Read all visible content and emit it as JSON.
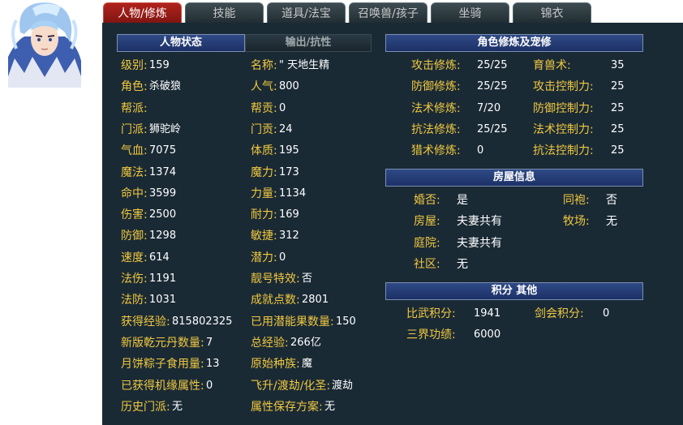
{
  "tabs": [
    "人物/修炼",
    "技能",
    "道具/法宝",
    "召唤兽/孩子",
    "坐骑",
    "锦衣"
  ],
  "status_header": "人物状态",
  "output_tab": "输出/抗性",
  "left_rows": [
    {
      "l1": "级别:",
      "v1": "159",
      "l2": "名称:",
      "v2": "\" 天地生精"
    },
    {
      "l1": "角色:",
      "v1": "杀破狼",
      "l2": "人气:",
      "v2": "800"
    },
    {
      "l1": "帮派:",
      "v1": "",
      "l2": "帮贡:",
      "v2": "0"
    },
    {
      "l1": "门派:",
      "v1": "狮驼岭",
      "l2": "门贡:",
      "v2": "24"
    },
    {
      "l1": "气血:",
      "v1": "7075",
      "l2": "体质:",
      "v2": "195"
    },
    {
      "l1": "魔法:",
      "v1": "1374",
      "l2": "魔力:",
      "v2": "173"
    },
    {
      "l1": "命中:",
      "v1": "3599",
      "l2": "力量:",
      "v2": "1134"
    },
    {
      "l1": "伤害:",
      "v1": "2500",
      "l2": "耐力:",
      "v2": "169"
    },
    {
      "l1": "防御:",
      "v1": "1298",
      "l2": "敏捷:",
      "v2": "312"
    },
    {
      "l1": "速度:",
      "v1": "614",
      "l2": "潜力:",
      "v2": "0"
    },
    {
      "l1": "法伤:",
      "v1": "1191",
      "l2": "靓号特效:",
      "v2": "否"
    },
    {
      "l1": "法防:",
      "v1": "1031",
      "l2": "成就点数:",
      "v2": "2801"
    },
    {
      "l1": "获得经验:",
      "v1": "815802325",
      "l2": "已用潜能果数量:",
      "v2": "150"
    },
    {
      "l1": "新版乾元丹数量:",
      "v1": "7",
      "l2": "总经验:",
      "v2": "266亿"
    },
    {
      "l1": "月饼粽子食用量:",
      "v1": "13",
      "l2": "原始种族:",
      "v2": "魔"
    },
    {
      "l1": "已获得机缘属性:",
      "v1": "0",
      "l2": "飞升/渡劫/化圣:",
      "v2": "渡劫"
    },
    {
      "l1": "历史门派:",
      "v1": "无",
      "l2": "属性保存方案:",
      "v2": "无"
    }
  ],
  "cultivation_header": "角色修炼及宠修",
  "cultivation_rows": [
    {
      "l1": "攻击修炼:",
      "v1": "25/25",
      "l2": "育兽术:",
      "v2": "35"
    },
    {
      "l1": "防御修炼:",
      "v1": "25/25",
      "l2": "攻击控制力:",
      "v2": "25"
    },
    {
      "l1": "法术修炼:",
      "v1": "7/20",
      "l2": "防御控制力:",
      "v2": "25"
    },
    {
      "l1": "抗法修炼:",
      "v1": "25/25",
      "l2": "法术控制力:",
      "v2": "25"
    },
    {
      "l1": "猎术修炼:",
      "v1": "0",
      "l2": "抗法控制力:",
      "v2": "25"
    }
  ],
  "house_header": "房屋信息",
  "house_rows": [
    {
      "l1": "婚否:",
      "v1": "是",
      "l2": "同袍:",
      "v2": "否"
    },
    {
      "l1": "房屋:",
      "v1": "夫妻共有",
      "l2": "牧场:",
      "v2": "无"
    },
    {
      "l1": "庭院:",
      "v1": "夫妻共有",
      "l2": "",
      "v2": ""
    },
    {
      "l1": "社区:",
      "v1": "无",
      "l2": "",
      "v2": ""
    }
  ],
  "score_header": "积分 其他",
  "score_rows": [
    {
      "l1": "比武积分:",
      "v1": "1941",
      "l2": "剑会积分:",
      "v2": "0"
    },
    {
      "l1": "三界功绩:",
      "v1": "6000",
      "l2": "",
      "v2": ""
    }
  ],
  "colors": {
    "panel": "#1a2a35",
    "label": "#f0c840",
    "value": "#ffffff",
    "active_tab": "#b0231c",
    "header": "#2f4a86"
  }
}
